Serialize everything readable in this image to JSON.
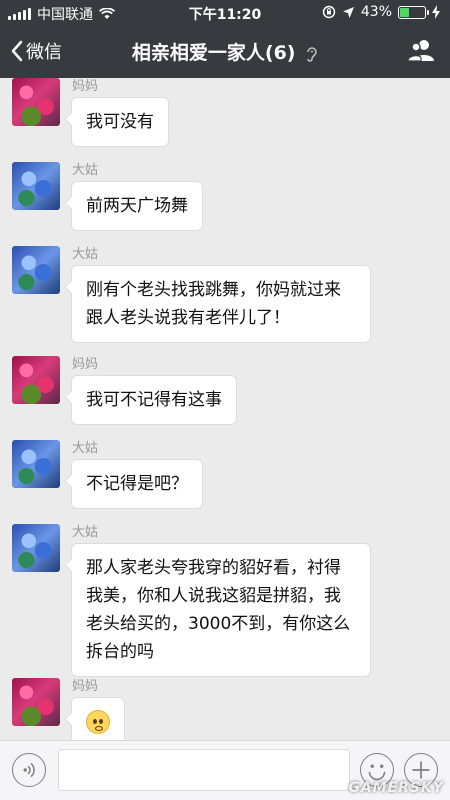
{
  "status_bar": {
    "carrier": "中国联通",
    "time": "下午11:20",
    "battery_percent": "43%",
    "battery_level": 0.43
  },
  "nav": {
    "back_label": "微信",
    "title": "相亲相爱一家人(6)"
  },
  "messages": [
    {
      "sender": "妈妈",
      "avatar": "mom-avatar",
      "text": "我可没有"
    },
    {
      "sender": "大姑",
      "avatar": "aunt-avatar",
      "text": "前两天广场舞"
    },
    {
      "sender": "大姑",
      "avatar": "aunt-avatar",
      "text": "刚有个老头找我跳舞，你妈就过来跟人老头说我有老伴儿了！"
    },
    {
      "sender": "妈妈",
      "avatar": "mom-avatar",
      "text": "我可不记得有这事"
    },
    {
      "sender": "大姑",
      "avatar": "aunt-avatar",
      "text": "不记得是吧？"
    },
    {
      "sender": "大姑",
      "avatar": "aunt-avatar",
      "text": "那人家老头夸我穿的貂好看，衬得我美，你和人说我这貂是拼貂，我老头给买的，3000不到，有你这么拆台的吗"
    },
    {
      "sender": "妈妈",
      "avatar": "mom-avatar",
      "emoji": "smirk-emoji-icon"
    }
  ],
  "input": {
    "value": ""
  },
  "watermark": "GAMERSKY",
  "colors": {
    "header_bg": "#393a3f",
    "chat_bg": "#ebebeb",
    "bubble_bg": "#ffffff"
  }
}
